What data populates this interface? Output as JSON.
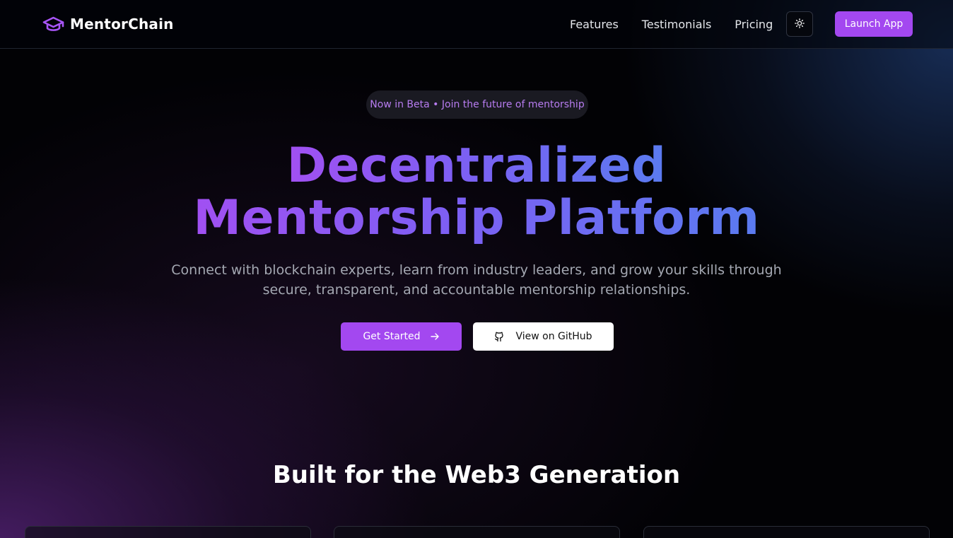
{
  "nav": {
    "brand": "MentorChain",
    "links": [
      "Features",
      "Testimonials",
      "Pricing"
    ],
    "launch_label": "Launch App"
  },
  "hero": {
    "badge": "Now in Beta • Join the future of mentorship",
    "headline_line1": "Decentralized",
    "headline_line2": "Mentorship Platform",
    "subtext": "Connect with blockchain experts, learn from industry leaders, and grow your skills through secure, transparent, and accountable mentorship relationships.",
    "primary_cta": "Get Started",
    "secondary_cta": "View on GitHub"
  },
  "features": {
    "title": "Built for the Web3 Generation"
  },
  "colors": {
    "accent": "#a348f0",
    "gradient_start": "#a150f2",
    "gradient_end": "#5a7bf0"
  },
  "icons": {
    "brand": "graduation-cap-icon",
    "theme": "sun-icon",
    "primary_cta": "arrow-right-icon",
    "secondary_cta": "github-icon"
  }
}
